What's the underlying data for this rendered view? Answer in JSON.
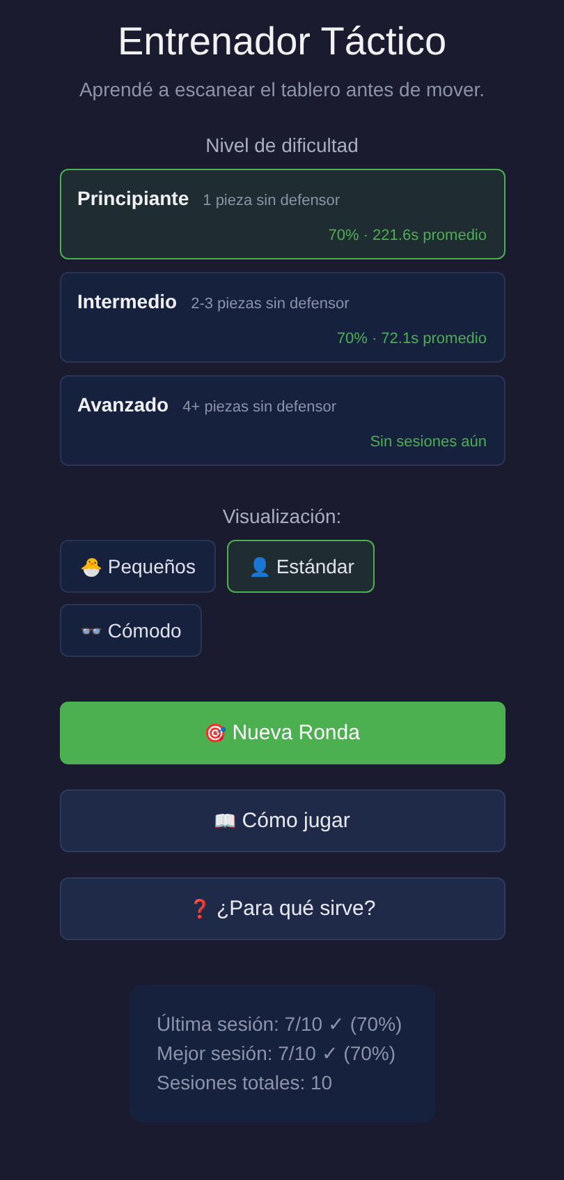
{
  "title": "Entrenador Táctico",
  "subtitle": "Aprendé a escanear el tablero antes de mover.",
  "difficulty": {
    "heading": "Nivel de dificultad",
    "levels": [
      {
        "name": "Principiante",
        "description": "1 pieza sin defensor",
        "stats": "70% · 221.6s promedio",
        "selected": true
      },
      {
        "name": "Intermedio",
        "description": "2-3 piezas sin defensor",
        "stats": "70% · 72.1s promedio",
        "selected": false
      },
      {
        "name": "Avanzado",
        "description": "4+ piezas sin defensor",
        "stats": "Sin sesiones aún",
        "selected": false
      }
    ]
  },
  "display": {
    "heading": "Visualización:",
    "options": [
      {
        "icon": "🐣",
        "label": "Pequeños",
        "selected": false
      },
      {
        "icon": "👤",
        "label": "Estándar",
        "selected": true
      },
      {
        "icon": "👓",
        "label": "Cómodo",
        "selected": false
      }
    ]
  },
  "actions": [
    {
      "kind": "primary",
      "icon": "🎯",
      "label": "Nueva Ronda"
    },
    {
      "kind": "secondary",
      "icon": "📖",
      "label": "Cómo jugar"
    },
    {
      "kind": "secondary",
      "icon": "❓",
      "label": "¿Para qué sirve?"
    }
  ],
  "stats": [
    "Última sesión: 7/10 ✓ (70%)",
    "Mejor sesión: 7/10 ✓ (70%)",
    "Sesiones totales: 10"
  ]
}
